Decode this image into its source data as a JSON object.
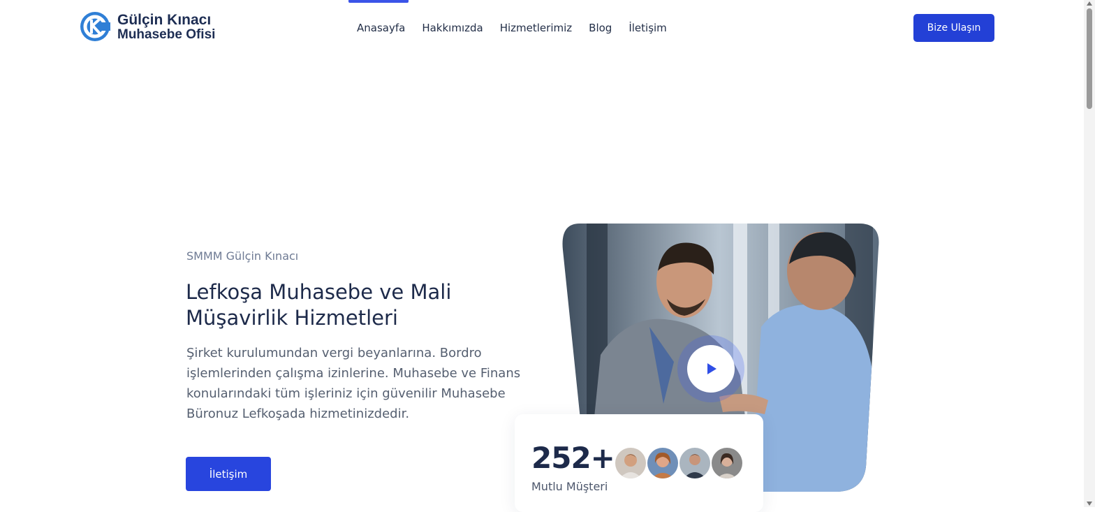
{
  "brand": {
    "line1": "Gülçin Kınacı",
    "line2": "Muhasebe Ofisi"
  },
  "nav": {
    "items": [
      "Anasayfa",
      "Hakkımızda",
      "Hizmetlerimiz",
      "Blog",
      "İletişim"
    ],
    "active": "Anasayfa"
  },
  "header_cta": "Bize Ulaşın",
  "hero": {
    "eyebrow": "SMMM Gülçin Kınacı",
    "title": "Lefkoşa Muhasebe ve Mali Müşavirlik Hizmetleri",
    "description": "Şirket kurulumundan vergi beyanlarına. Bordro işlemlerinden çalışma izinlerine. Muhasebe ve Finans konularındaki tüm işleriniz için güvenilir Muhasebe Büronuz Lefkoşada hizmetinizdedir.",
    "button": "İletişim"
  },
  "stats": {
    "count": "252+",
    "label": "Mutlu Müşteri"
  },
  "icons": {
    "play": "play-icon",
    "logo": "logo-icon"
  },
  "colors": {
    "accent": "#2340d6",
    "title": "#1d2a4a"
  }
}
